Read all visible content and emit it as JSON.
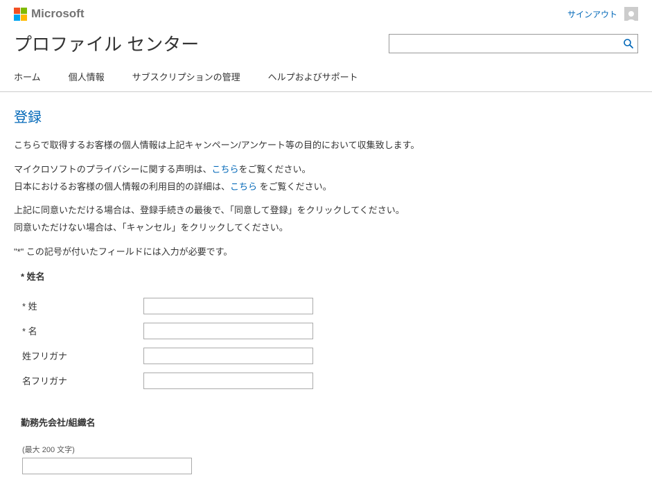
{
  "header": {
    "brand": "Microsoft",
    "signout": "サインアウト",
    "title": "プロファイル センター",
    "search_placeholder": ""
  },
  "nav": {
    "home": "ホーム",
    "personal": "個人情報",
    "subscription": "サブスクリプションの管理",
    "help": "ヘルプおよびサポート"
  },
  "page": {
    "heading": "登録",
    "intro": "こちらで取得するお客様の個人情報は上記キャンペーン/アンケート等の目的において収集致します。",
    "privacy_prefix": "マイクロソフトのプライバシーに関する声明は、",
    "privacy_link": "こちら",
    "privacy_suffix": "をご覧ください。",
    "jp_prefix": "日本におけるお客様の個人情報の利用目的の詳細は、",
    "jp_link": "こちら",
    "jp_suffix": " をご覧ください。",
    "consent1": "上記に同意いただける場合は、登録手続きの最後で、「同意して登録」をクリックしてください。",
    "consent2": "同意いただけない場合は、「キャンセル」をクリックしてください。",
    "required_note": "\"*\" この記号が付いたフィールドには入力が必要です。"
  },
  "sections": {
    "name": "* 姓名",
    "org": "勤務先会社/組織名"
  },
  "fields": {
    "lastname_label": "* 姓",
    "lastname_value": "",
    "firstname_label": "* 名",
    "firstname_value": "",
    "lastname_kana_label": "姓フリガナ",
    "lastname_kana_value": "",
    "firstname_kana_label": "名フリガナ",
    "firstname_kana_value": "",
    "org_hint": "(最大 200 文字)",
    "org_value": ""
  }
}
